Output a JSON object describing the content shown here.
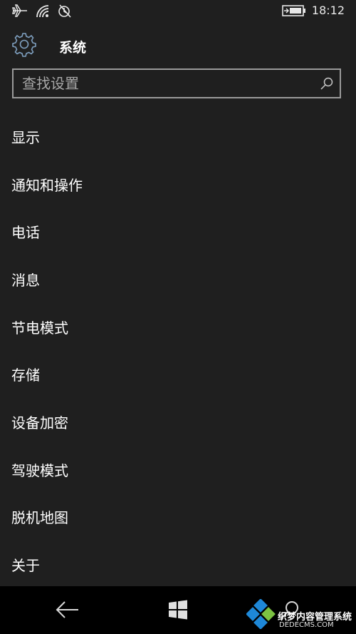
{
  "status_bar": {
    "time": "18:12",
    "icons": [
      "airplane-icon",
      "wifi-icon",
      "alarm-off-icon",
      "battery-charging-icon"
    ]
  },
  "header": {
    "title": "系统",
    "icon": "gear-icon"
  },
  "search": {
    "placeholder": "查找设置",
    "value": "",
    "icon": "search-icon"
  },
  "menu": {
    "items": [
      {
        "label": "显示"
      },
      {
        "label": "通知和操作"
      },
      {
        "label": "电话"
      },
      {
        "label": "消息"
      },
      {
        "label": "节电模式"
      },
      {
        "label": "存储"
      },
      {
        "label": "设备加密"
      },
      {
        "label": "驾驶模式"
      },
      {
        "label": "脱机地图"
      },
      {
        "label": "关于"
      }
    ]
  },
  "nav_bar": {
    "icons": [
      "back-arrow-icon",
      "windows-start-icon",
      "search-icon"
    ]
  },
  "watermark": {
    "text": "织梦内容管理系统",
    "sub": "DEDECMS.COM"
  },
  "colors": {
    "background": "#1f1f1f",
    "nav_background": "#000000",
    "text": "#ffffff",
    "search_border": "#9a9a9a",
    "placeholder": "#a8a8a8",
    "watermark_blue": "#1e88d8"
  }
}
